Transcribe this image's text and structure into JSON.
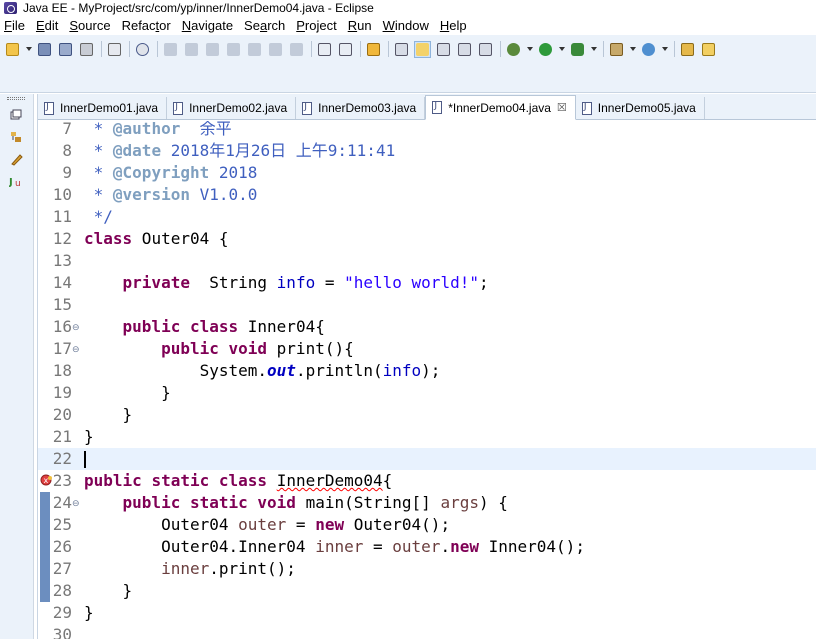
{
  "window": {
    "title": "Java EE - MyProject/src/com/yp/inner/InnerDemo04.java - Eclipse"
  },
  "menu": [
    {
      "pre": "",
      "u": "F",
      "post": "ile"
    },
    {
      "pre": "",
      "u": "E",
      "post": "dit"
    },
    {
      "pre": "",
      "u": "S",
      "post": "ource"
    },
    {
      "pre": "Refac",
      "u": "t",
      "post": "or"
    },
    {
      "pre": "",
      "u": "N",
      "post": "avigate"
    },
    {
      "pre": "Se",
      "u": "a",
      "post": "rch"
    },
    {
      "pre": "",
      "u": "P",
      "post": "roject"
    },
    {
      "pre": "",
      "u": "R",
      "post": "un"
    },
    {
      "pre": "",
      "u": "W",
      "post": "indow"
    },
    {
      "pre": "",
      "u": "H",
      "post": "elp"
    }
  ],
  "tabs": [
    {
      "label": "InnerDemo01.java",
      "active": false
    },
    {
      "label": "InnerDemo02.java",
      "active": false
    },
    {
      "label": "InnerDemo03.java",
      "active": false
    },
    {
      "label": "*InnerDemo04.java",
      "active": true
    },
    {
      "label": "InnerDemo05.java",
      "active": false
    }
  ],
  "tab_close_glyph": "☒",
  "colors": {
    "keyword": "#7f0055",
    "javadoc": "#3f5fbf",
    "string": "#2a00ff",
    "field": "#0000c0",
    "current_line": "#e8f2fe",
    "toolbar_bg": "#ebf2fa"
  },
  "editor": {
    "current_line": 22,
    "lines": [
      {
        "n": "7",
        "fold": "",
        "tokens": [
          [
            " * ",
            "cm"
          ],
          [
            "@author",
            "tag"
          ],
          [
            "  余平",
            "cm"
          ]
        ]
      },
      {
        "n": "8",
        "fold": "",
        "tokens": [
          [
            " * ",
            "cm"
          ],
          [
            "@date",
            "tag"
          ],
          [
            " 2018年1月26日 上午9:11:41",
            "cm"
          ]
        ]
      },
      {
        "n": "9",
        "fold": "",
        "tokens": [
          [
            " * ",
            "cm"
          ],
          [
            "@Copyright",
            "tag"
          ],
          [
            " 2018",
            "cm"
          ]
        ]
      },
      {
        "n": "10",
        "fold": "",
        "tokens": [
          [
            " * ",
            "cm"
          ],
          [
            "@version",
            "tag"
          ],
          [
            " V1.0.0",
            "cm"
          ]
        ]
      },
      {
        "n": "11",
        "fold": "",
        "tokens": [
          [
            " */",
            "cm"
          ]
        ]
      },
      {
        "n": "12",
        "fold": "",
        "tokens": [
          [
            "class",
            "kw"
          ],
          [
            " Outer04 {",
            ""
          ]
        ]
      },
      {
        "n": "13",
        "fold": "",
        "tokens": []
      },
      {
        "n": "14",
        "fold": "",
        "tokens": [
          [
            "    ",
            ""
          ],
          [
            "private",
            "kw"
          ],
          [
            "  String ",
            ""
          ],
          [
            "info",
            "fld"
          ],
          [
            " = ",
            ""
          ],
          [
            "\"hello world!\"",
            "str"
          ],
          [
            ";",
            ""
          ]
        ]
      },
      {
        "n": "15",
        "fold": "",
        "tokens": []
      },
      {
        "n": "16",
        "fold": "⊖",
        "tokens": [
          [
            "    ",
            ""
          ],
          [
            "public",
            "kw"
          ],
          [
            " ",
            ""
          ],
          [
            "class",
            "kw"
          ],
          [
            " Inner04{",
            ""
          ]
        ]
      },
      {
        "n": "17",
        "fold": "⊖",
        "tokens": [
          [
            "        ",
            ""
          ],
          [
            "public",
            "kw"
          ],
          [
            " ",
            ""
          ],
          [
            "void",
            "kw"
          ],
          [
            " print(){",
            ""
          ]
        ]
      },
      {
        "n": "18",
        "fold": "",
        "tokens": [
          [
            "            System.",
            ""
          ],
          [
            "out",
            "sfld"
          ],
          [
            ".println(",
            ""
          ],
          [
            "info",
            "fld"
          ],
          [
            ");",
            ""
          ]
        ]
      },
      {
        "n": "19",
        "fold": "",
        "tokens": [
          [
            "        }",
            ""
          ]
        ]
      },
      {
        "n": "20",
        "fold": "",
        "tokens": [
          [
            "    }",
            ""
          ]
        ]
      },
      {
        "n": "21",
        "fold": "",
        "tokens": [
          [
            "}",
            ""
          ]
        ]
      },
      {
        "n": "22",
        "fold": "",
        "tokens": []
      },
      {
        "n": "23",
        "fold": "",
        "tokens": [
          [
            "public",
            "kw"
          ],
          [
            " ",
            ""
          ],
          [
            "static",
            "kw"
          ],
          [
            " ",
            ""
          ],
          [
            "class",
            "kw"
          ],
          [
            " ",
            ""
          ],
          [
            "InnerDemo04",
            "err"
          ],
          [
            "{",
            ""
          ]
        ]
      },
      {
        "n": "24",
        "fold": "⊖",
        "tokens": [
          [
            "    ",
            ""
          ],
          [
            "public",
            "kw"
          ],
          [
            " ",
            ""
          ],
          [
            "static",
            "kw"
          ],
          [
            " ",
            ""
          ],
          [
            "void",
            "kw"
          ],
          [
            " main(String[] ",
            ""
          ],
          [
            "args",
            "loc"
          ],
          [
            ") {",
            ""
          ]
        ]
      },
      {
        "n": "25",
        "fold": "",
        "tokens": [
          [
            "        Outer04 ",
            ""
          ],
          [
            "outer",
            "loc"
          ],
          [
            " = ",
            ""
          ],
          [
            "new",
            "kw"
          ],
          [
            " Outer04();",
            ""
          ]
        ]
      },
      {
        "n": "26",
        "fold": "",
        "tokens": [
          [
            "        Outer04.Inner04 ",
            ""
          ],
          [
            "inner",
            "loc"
          ],
          [
            " = ",
            ""
          ],
          [
            "outer",
            "loc"
          ],
          [
            ".",
            ""
          ],
          [
            "new",
            "kw"
          ],
          [
            " Inner04();",
            ""
          ]
        ]
      },
      {
        "n": "27",
        "fold": "",
        "tokens": [
          [
            "        ",
            ""
          ],
          [
            "inner",
            "loc"
          ],
          [
            ".print();",
            ""
          ]
        ]
      },
      {
        "n": "28",
        "fold": "",
        "tokens": [
          [
            "    }",
            ""
          ]
        ]
      },
      {
        "n": "29",
        "fold": "",
        "tokens": [
          [
            "}",
            ""
          ]
        ]
      },
      {
        "n": "30",
        "fold": "",
        "tokens": []
      }
    ]
  }
}
